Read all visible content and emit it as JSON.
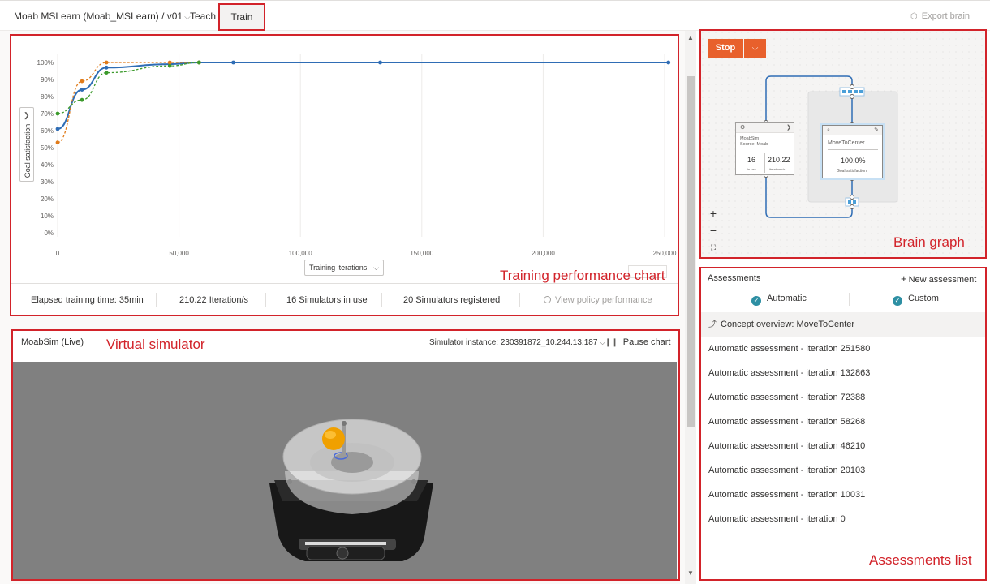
{
  "topbar": {
    "project": "Moab MSLearn (Moab_MSLearn) / v01",
    "tab_teach": "Teach",
    "tab_train": "Train",
    "export_label": "Export brain",
    "export_icon": "cube-icon",
    "project_chevron": "chevron-down-icon"
  },
  "callouts": {
    "perf": "Training performance chart",
    "sim": "Virtual simulator",
    "brain": "Brain graph",
    "assess": "Assessments list"
  },
  "chart": {
    "ylabel": "Goal satisfaction",
    "xaxis_select": "Training iterations"
  },
  "chart_data": {
    "type": "line",
    "ylabel": "Goal satisfaction",
    "xlabel": "Training iterations",
    "ylim": [
      0,
      100
    ],
    "xlim": [
      0,
      250000
    ],
    "yticks": [
      "100%",
      "90%",
      "80%",
      "70%",
      "60%",
      "50%",
      "40%",
      "30%",
      "20%",
      "10%",
      "0%"
    ],
    "xticks": [
      "0",
      "50,000",
      "100,000",
      "150,000",
      "200,000",
      "250,000"
    ],
    "grid": true,
    "series": [
      {
        "color": "#2f6db5",
        "style": "solid",
        "x": [
          0,
          10031,
          20103,
          46210,
          58268,
          72388,
          132863,
          251580
        ],
        "y": [
          61,
          84,
          97,
          99,
          100,
          100,
          100,
          100
        ]
      },
      {
        "color": "#e07b1a",
        "style": "dashed",
        "x": [
          0,
          10031,
          20103,
          46210,
          58268
        ],
        "y": [
          53,
          89,
          100,
          100,
          100
        ]
      },
      {
        "color": "#3c9a2c",
        "style": "dashed",
        "x": [
          0,
          10031,
          20103,
          46210,
          58268
        ],
        "y": [
          70,
          78,
          94,
          98,
          100
        ]
      }
    ]
  },
  "stats": {
    "elapsed": "Elapsed training time: 35min",
    "rate": "210.22 Iteration/s",
    "sims_in_use": "16 Simulators in use",
    "sims_registered": "20 Simulators registered",
    "view_policy": "View policy performance"
  },
  "sim": {
    "title": "MoabSim (Live)",
    "instance": "Simulator instance: 230391872_10.244.13.187",
    "pause": "Pause chart"
  },
  "brain": {
    "stop": "Stop",
    "sim_node": {
      "name": "MoabSim",
      "source": "Source: Moab",
      "count": "16",
      "count_label": "in use",
      "rate": "210.22",
      "rate_label": "iterations/s"
    },
    "concept_node": {
      "name": "MoveToCenter",
      "value": "100.0%",
      "value_label": "Goal satisfaction"
    },
    "zoom_in": "+",
    "zoom_out": "−",
    "fit": "⛶"
  },
  "assess": {
    "title": "Assessments",
    "new": "New assessment",
    "filter_automatic": "Automatic",
    "filter_custom": "Custom",
    "concept_overview": "Concept overview: MoveToCenter",
    "items": [
      "Automatic assessment - iteration 251580",
      "Automatic assessment - iteration 132863",
      "Automatic assessment - iteration 72388",
      "Automatic assessment - iteration 58268",
      "Automatic assessment - iteration 46210",
      "Automatic assessment - iteration 20103",
      "Automatic assessment - iteration 10031",
      "Automatic assessment - iteration 0"
    ]
  }
}
